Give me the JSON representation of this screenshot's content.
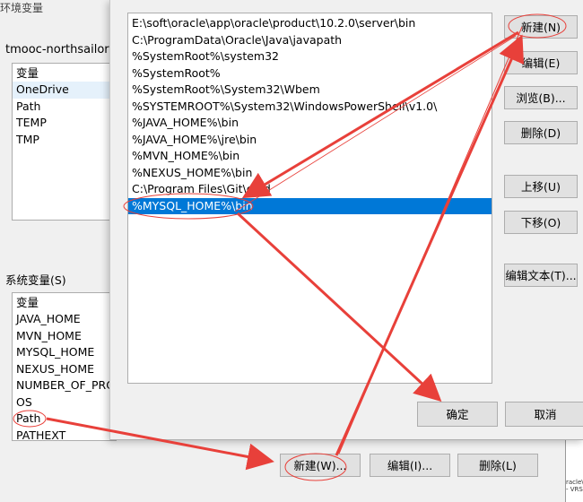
{
  "env_dialog": {
    "title": "环境变量",
    "user_vars_label": "tmooc-northsailor 的",
    "user_vars": {
      "header": "变量",
      "items": [
        "OneDrive",
        "Path",
        "TEMP",
        "TMP"
      ]
    },
    "sys_vars_label": "系统变量(S)",
    "sys_vars": {
      "header": "变量",
      "items": [
        "JAVA_HOME",
        "MVN_HOME",
        "MYSQL_HOME",
        "NEXUS_HOME",
        "NUMBER_OF_PRO",
        "OS",
        "Path",
        "PATHEXT"
      ]
    },
    "buttons": {
      "new": "新建(W)...",
      "edit": "编辑(I)...",
      "delete": "删除(L)"
    }
  },
  "edit_dialog": {
    "paths": [
      "E:\\soft\\oracle\\app\\oracle\\product\\10.2.0\\server\\bin",
      "C:\\ProgramData\\Oracle\\Java\\javapath",
      "%SystemRoot%\\system32",
      "%SystemRoot%",
      "%SystemRoot%\\System32\\Wbem",
      "%SYSTEMROOT%\\System32\\WindowsPowerShell\\v1.0\\",
      "%JAVA_HOME%\\bin",
      "%JAVA_HOME%\\jre\\bin",
      "%MVN_HOME%\\bin",
      "%NEXUS_HOME%\\bin",
      "C:\\Program Files\\Git\\cmd",
      "%MYSQL_HOME%\\bin"
    ],
    "buttons": {
      "new": "新建(N)",
      "edit": "编辑(E)",
      "browse": "浏览(B)...",
      "delete": "删除(D)",
      "move_up": "上移(U)",
      "move_down": "下移(O)",
      "edit_text": "编辑文本(T)...",
      "ok": "确定",
      "cancel": "取消"
    }
  },
  "right_strip": {
    "line1": "racle\\",
    "line2": "- VRS"
  },
  "annotation_color": "#e8403a"
}
